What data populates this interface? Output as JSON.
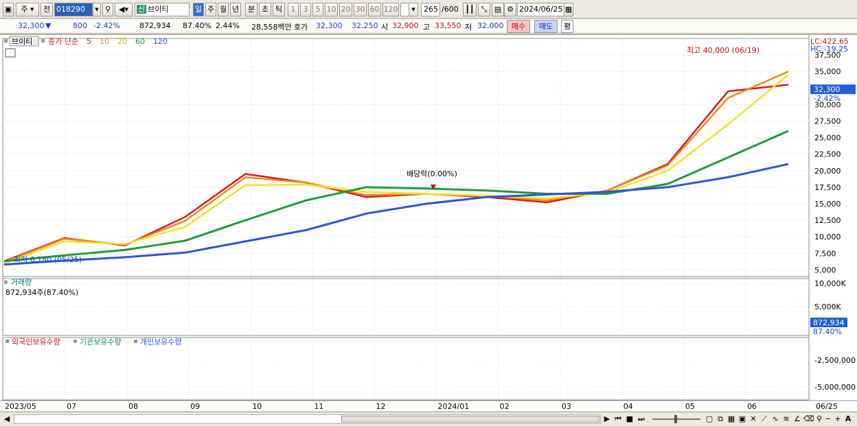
{
  "toolbar": {
    "market": "주",
    "prev_label": "전",
    "code": "018290",
    "name_tag": "신",
    "name": "브이티",
    "period_buttons": [
      "일",
      "주",
      "월",
      "년",
      "분",
      "초",
      "틱"
    ],
    "interval_buttons": [
      "1",
      "3",
      "5",
      "10",
      "20",
      "30",
      "60",
      "120"
    ],
    "count": "265",
    "count_max": "/600",
    "date": "2024/06/25"
  },
  "quote": {
    "price": "32,300",
    "change_arrow": "▼",
    "change": "800",
    "change_pct": "-2.42%",
    "volume": "872,934",
    "volume_ratio": "87.40%",
    "turnover_rate": "2.44%",
    "amount": "28,558백만",
    "bid_label": "호가",
    "ask_price": "32,300",
    "bid_price": "32,250",
    "open_label": "시",
    "open": "32,900",
    "high_label": "고",
    "high": "33,550",
    "low_label": "저",
    "low": "32,000",
    "buy_button": "매수",
    "sell_button": "매도",
    "eval_button": "평"
  },
  "price_pane": {
    "legend_name": "브이티",
    "legend_ma_label": "종가 단순",
    "ma_periods": [
      "5",
      "10",
      "20",
      "60",
      "120"
    ],
    "ma_colors": [
      "#d81a1a",
      "#f08a1a",
      "#f2e22a",
      "#1e9a3e",
      "#2a56d8"
    ],
    "lc_label": "LC:422.65",
    "hc_label": "HC:-19.25",
    "max_annotation": "최고 40,000 (06/19)",
    "min_annotation": "최저 6,180 (05/25)",
    "dividend_annotation": "배당락(0.00%)",
    "y_ticks": [
      "37,500",
      "35,000",
      "32,500",
      "30,000",
      "27,500",
      "25,000",
      "22,500",
      "20,000",
      "17,500",
      "15,000",
      "12,500",
      "10,000",
      "7,500",
      "5,000"
    ],
    "current_price": "32,300",
    "current_change": "-2.42%"
  },
  "volume_pane": {
    "title": "거래량",
    "value_label": "872,934주(87.40%)",
    "y_ticks": [
      "10,000K",
      "5,000K"
    ],
    "current_value": "872,934",
    "current_ratio": "87.40%"
  },
  "holding_pane": {
    "series": [
      "외국인보유수량",
      "기관보유수량",
      "개인보유수량"
    ],
    "y_ticks": [
      "-2,500,000",
      "-5,000,000"
    ]
  },
  "x_axis": {
    "labels": [
      "2023/05",
      "07",
      "08",
      "09",
      "10",
      "11",
      "12",
      "2024/01",
      "02",
      "03",
      "04",
      "05",
      "06"
    ],
    "last_label": "06/25"
  },
  "chart_data": {
    "type": "line",
    "title": "",
    "xlabel": "",
    "ylabel": "",
    "ylim": [
      4000,
      40000
    ],
    "x": [
      "2023/05",
      "07",
      "08",
      "09",
      "10",
      "11",
      "12",
      "2024/01",
      "02",
      "03",
      "04",
      "05",
      "06",
      "06/25"
    ],
    "series": [
      {
        "name": "5",
        "values": [
          6300,
          9800,
          8700,
          13000,
          19500,
          18200,
          16000,
          16500,
          16000,
          15200,
          17000,
          21000,
          32000,
          33000
        ]
      },
      {
        "name": "10",
        "values": [
          6200,
          9700,
          8800,
          12400,
          19000,
          18200,
          16300,
          16500,
          16200,
          15500,
          17000,
          20800,
          31000,
          35000
        ]
      },
      {
        "name": "20",
        "values": [
          6000,
          9300,
          8900,
          11500,
          17800,
          17900,
          16800,
          16500,
          16200,
          15800,
          16700,
          20000,
          27000,
          34500
        ]
      },
      {
        "name": "60",
        "values": [
          6300,
          7200,
          8000,
          9400,
          12500,
          15500,
          17500,
          17300,
          17000,
          16500,
          16500,
          18000,
          22000,
          26000
        ]
      },
      {
        "name": "120",
        "values": [
          5800,
          6400,
          6900,
          7600,
          9300,
          11000,
          13500,
          15000,
          16000,
          16400,
          16800,
          17500,
          19000,
          21000
        ]
      }
    ],
    "grid": true,
    "legend": "top-left"
  }
}
